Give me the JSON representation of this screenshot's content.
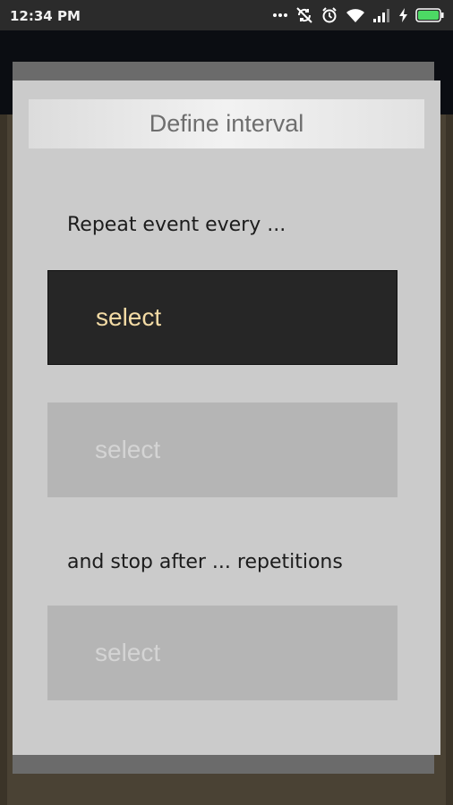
{
  "status_bar": {
    "time": "12:34 PM",
    "icons": [
      "more-icon",
      "sync-off-icon",
      "alarm-icon",
      "wifi-icon",
      "signal-icon",
      "charging-icon",
      "battery-icon"
    ]
  },
  "dialog": {
    "title": "Define interval",
    "repeat_label": "Repeat event every ...",
    "select_interval_label": "select",
    "select_unit_label": "select",
    "stop_label": "and stop after ... repetitions",
    "select_repetitions_label": "select"
  },
  "colors": {
    "select_active_bg": "#262626",
    "select_active_text": "#f3dba5",
    "select_disabled_bg": "#b5b5b5",
    "dialog_bg": "#cbcbcb",
    "battery_green": "#4cd964"
  }
}
